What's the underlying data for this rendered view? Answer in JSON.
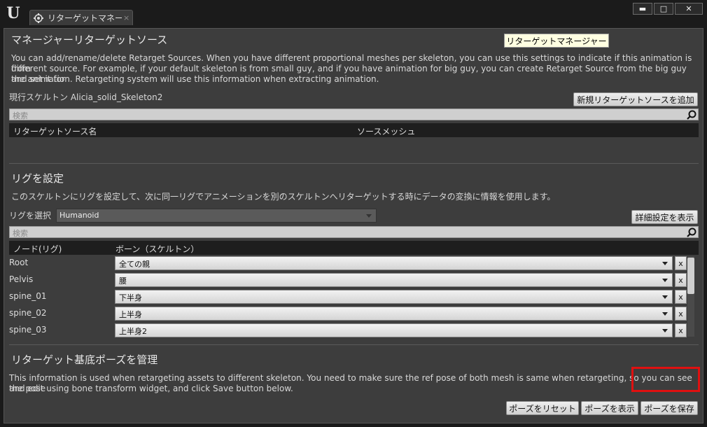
{
  "window": {
    "tab_label": "リターゲットマネー",
    "tab_close": "×",
    "minimize": "▬",
    "maximize": "□",
    "close": "✕"
  },
  "tooltip": "リターゲットマネージャー",
  "sources": {
    "title": "マネージャーリターゲットソース",
    "description_lines": [
      "You can add/rename/delete Retarget Sources. When you have different proportional meshes per skeleton, you can use this settings to indicate if this animation is from",
      "different source. For example, if your default skeleton is from small guy, and if you have animation for big guy, you can create Retarget Source from the big guy and set it for",
      "the animation. Retargeting system will use this information when extracting animation."
    ],
    "current_skeleton": "現行スケルトン Alicia_solid_Skeleton2",
    "add_button": "新規リターゲットソースを追加",
    "search_placeholder": "検索",
    "col_source_name": "リターゲットソース名",
    "col_source_mesh": "ソースメッシュ"
  },
  "rig": {
    "title": "リグを設定",
    "description": "このスケルトンにリグを設定して、次に同一リグでアニメーションを別のスケルトンへリターゲットする時にデータの変換に情報を使用します。",
    "select_label": "リグを選択",
    "selected_rig": "Humanoid",
    "advanced_button": "詳細設定を表示",
    "search_placeholder": "検索",
    "col_node": "ノード(リグ)",
    "col_bone": "ボーン（スケルトン）",
    "rows": [
      {
        "node": "Root",
        "bone": "全ての親",
        "x": "x"
      },
      {
        "node": "Pelvis",
        "bone": "腰",
        "x": "x"
      },
      {
        "node": "spine_01",
        "bone": "下半身",
        "x": "x"
      },
      {
        "node": "spine_02",
        "bone": "上半身",
        "x": "x"
      },
      {
        "node": "spine_03",
        "bone": "上半身2",
        "x": "x"
      }
    ]
  },
  "pose": {
    "title": "リターゲット基底ポーズを管理",
    "description_lines": [
      "This information is used when retargeting assets to different skeleton. You need to make sure the ref pose of both mesh is same when retargeting, so you can see the pose",
      "and edit using bone transform widget, and click Save button below."
    ],
    "reset_button": "ポーズをリセット",
    "show_button": "ポーズを表示",
    "save_button": "ポーズを保存"
  },
  "colors": {
    "highlight": "#e01010",
    "panel": "#3d3d3d",
    "tooltip": "#ffffe1"
  }
}
